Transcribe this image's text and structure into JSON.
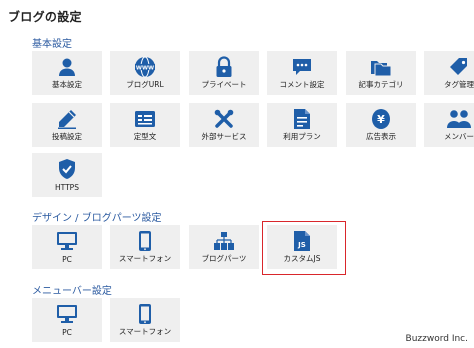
{
  "page": {
    "title": "ブログの設定"
  },
  "sections": [
    {
      "title": "基本設定"
    },
    {
      "title": "デザイン / ブログパーツ設定"
    },
    {
      "title": "メニューバー設定"
    }
  ],
  "basic_items": [
    {
      "label": "基本設定",
      "icon": "user-icon"
    },
    {
      "label": "ブログURL",
      "icon": "www-globe-icon"
    },
    {
      "label": "プライベート",
      "icon": "lock-icon"
    },
    {
      "label": "コメント設定",
      "icon": "comment-icon"
    },
    {
      "label": "記事カテゴリ",
      "icon": "folders-icon"
    },
    {
      "label": "タグ管理",
      "icon": "tag-icon"
    },
    {
      "label": "投稿設定",
      "icon": "pen-icon"
    },
    {
      "label": "定型文",
      "icon": "template-card-icon"
    },
    {
      "label": "外部サービス",
      "icon": "tools-icon"
    },
    {
      "label": "利用プラン",
      "icon": "plan-document-icon"
    },
    {
      "label": "広告表示",
      "icon": "yen-coin-icon"
    },
    {
      "label": "メンバー",
      "icon": "members-icon"
    },
    {
      "label": "HTTPS",
      "icon": "shield-check-icon"
    }
  ],
  "design_items": [
    {
      "label": "PC",
      "icon": "monitor-icon"
    },
    {
      "label": "スマートフォン",
      "icon": "smartphone-icon"
    },
    {
      "label": "ブログパーツ",
      "icon": "sitemap-icon"
    },
    {
      "label": "カスタムJS",
      "icon": "js-file-icon"
    }
  ],
  "menubar_items": [
    {
      "label": "PC",
      "icon": "monitor-icon"
    },
    {
      "label": "スマートフォン",
      "icon": "smartphone-icon"
    }
  ],
  "watermark": "Buzzword Inc.",
  "colors": {
    "icon": "#1f5ea8",
    "tile_bg": "#efefef",
    "section_title": "#2b5aa0",
    "highlight": "#d9262b"
  }
}
